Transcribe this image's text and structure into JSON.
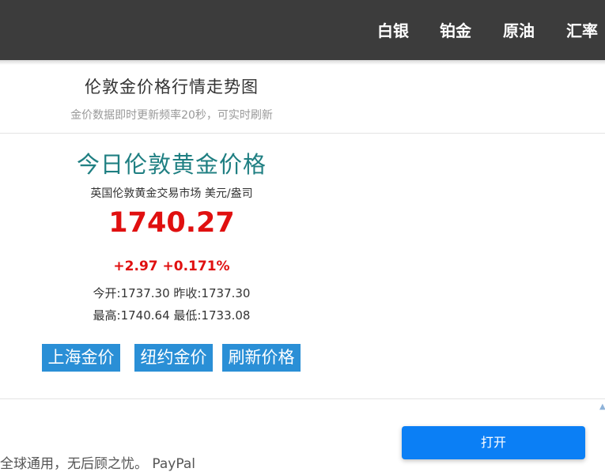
{
  "nav": {
    "items": [
      "白银",
      "铂金",
      "原油",
      "汇率"
    ]
  },
  "header": {
    "title": "伦敦金价格行情走势图",
    "subtitle": "金价数据即时更新频率20秒，可实时刷新"
  },
  "quote": {
    "title": "今日伦敦黄金价格",
    "market": "英国伦敦黄金交易市场 美元/盎司",
    "price": "1740.27",
    "change": "+2.97 +0.171%",
    "open_close": "今开:1737.30 昨收:1737.30",
    "high_low": "最高:1740.64 最低:1733.08"
  },
  "buttons": {
    "shanghai": "上海金价",
    "newyork": "纽约金价",
    "refresh": "刷新价格"
  },
  "bottom": {
    "text": "全球通用，无后顾之忧。 PayPal",
    "open_button": "打开"
  },
  "colors": {
    "topbar": "#3c3c3c",
    "title_teal": "#1f7f82",
    "price_red": "#e01010",
    "button_blue": "#2a8fd6",
    "open_blue": "#0b7ff5"
  }
}
